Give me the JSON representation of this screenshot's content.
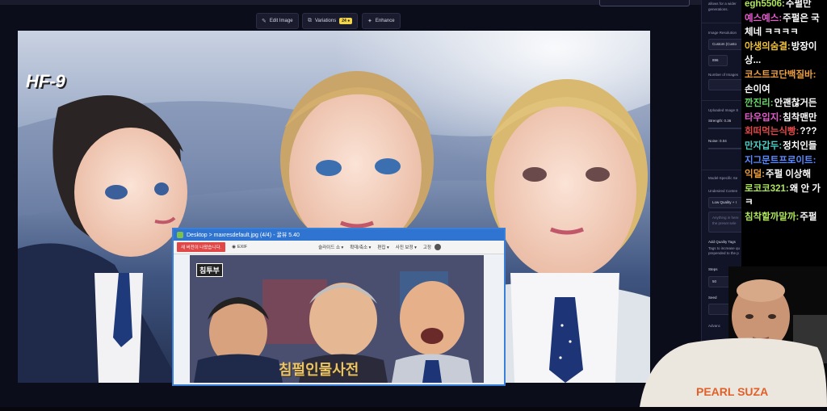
{
  "topbar": {
    "tagline_line1": "allows for a wider",
    "tagline_line2": "generations."
  },
  "toolbar": {
    "edit_label": "Edit Image",
    "variations_label": "Variations",
    "variations_badge": "24 ●",
    "enhance_label": "Enhance"
  },
  "panel": {
    "image_resolution": "Image Resolution",
    "resolution_value": "Custom (Custo",
    "width_value": "896",
    "number_of_images": "Number of Images",
    "uploaded_image": "Uploaded Image S",
    "strength": "Strength: 0.36",
    "noise": "Noise: 0.04",
    "model_specific": "Model-Specific Se",
    "undesired": "Undesired Conten",
    "low_quality": "Low Quality + I",
    "anything_line1": "Anything in here",
    "anything_line2": "the preset sele",
    "add_quality": "Add Quality Tags",
    "tags_line1": "Tags to increase qu",
    "tags_line2": "prepended to the p",
    "steps": "Steps",
    "steps_value": "50",
    "seed": "Seed",
    "advanced": "Advanc"
  },
  "overlay_logo": "HF-9",
  "viewer": {
    "title": "Desktop > maxresdefault.jpg (4/4) - 꿀뷰 5.40",
    "new_version": "새 버전이 나왔습니다.",
    "exif": "EXIF",
    "slideshow": "슬라이드 쇼 ▾",
    "zoom": "확대/축소 ▾",
    "edit": "편집 ▾",
    "photo_correction": "사진 보정 ▾",
    "pin": "고정",
    "photo_badge": "침투부",
    "photo_caption": "침펄인물사전"
  },
  "chat": [
    {
      "user": "egh5506:",
      "text": "주펄만",
      "color": "#aee65a"
    },
    {
      "user": "예스예스:",
      "text": "주펄은 국",
      "color": "#e85ad0"
    },
    {
      "user": "",
      "text": "체네 ㅋㅋㅋㅋ",
      "color": "#ffffff"
    },
    {
      "user": "야생의숨결:",
      "text": "방장이",
      "color": "#f0c23c"
    },
    {
      "user": "",
      "text": "상...",
      "color": "#ffffff"
    },
    {
      "user": "코스트코단백질바:",
      "text": "",
      "color": "#f0a03c"
    },
    {
      "user": "",
      "text": "손이여",
      "color": "#ffffff"
    },
    {
      "user": "깐진리:",
      "text": "안괜찮거든",
      "color": "#6ad86a"
    },
    {
      "user": "타우입지:",
      "text": "침착맨만",
      "color": "#e85ad0"
    },
    {
      "user": "회떠먹는식빵:",
      "text": "???",
      "color": "#e04848"
    },
    {
      "user": "만자갑두:",
      "text": "정치인들",
      "color": "#4ad0c8"
    },
    {
      "user": "지그문트프로이트:",
      "text": "",
      "color": "#5a8aff"
    },
    {
      "user": "익덜:",
      "text": "주펄 이상해",
      "color": "#f0a03c"
    },
    {
      "user": "로코코321:",
      "text": "왜 안 가",
      "color": "#aee65a"
    },
    {
      "user": "",
      "text": "ㅋ",
      "color": "#ffffff"
    },
    {
      "user": "침착할까말까:",
      "text": "주펄",
      "color": "#aee65a"
    }
  ],
  "webcam_shirt_text": "PEARL  SUZA"
}
